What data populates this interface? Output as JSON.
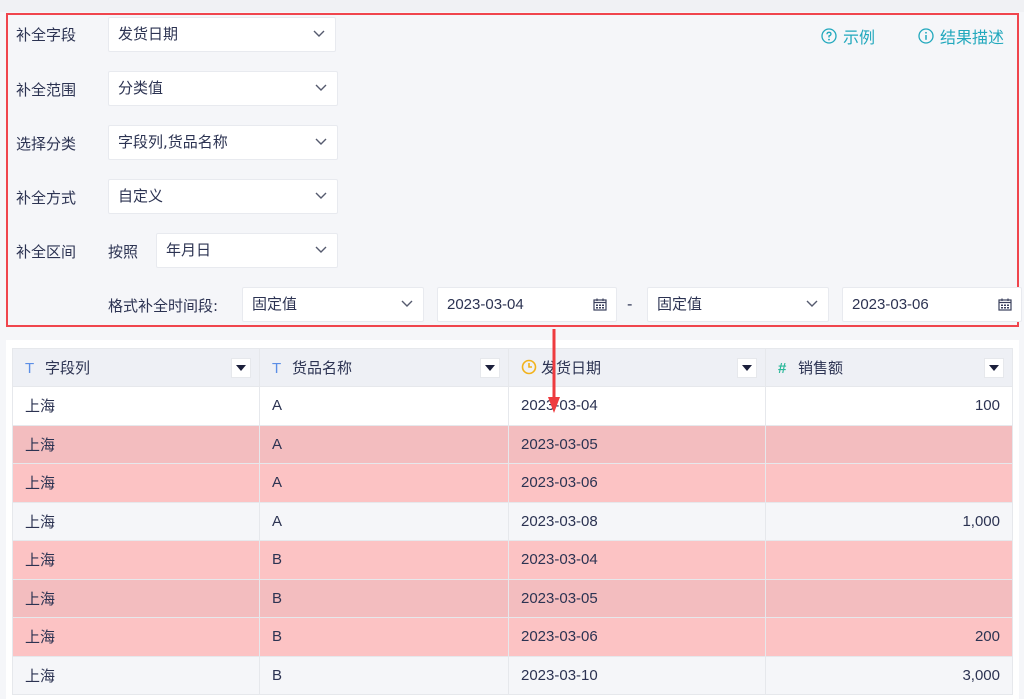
{
  "config": {
    "fill_field": {
      "label": "补全字段",
      "value": "发货日期"
    },
    "fill_scope": {
      "label": "补全范围",
      "value": "分类值"
    },
    "select_category": {
      "label": "选择分类",
      "value": "字段列,货品名称"
    },
    "fill_method": {
      "label": "补全方式",
      "value": "自定义"
    },
    "fill_interval": {
      "label": "补全区间",
      "by_label": "按照",
      "value": "年月日"
    },
    "time_range": {
      "label": "格式补全时间段:",
      "start_type": "固定值",
      "start_date": "2023-03-04",
      "separator": "-",
      "end_type": "固定值",
      "end_date": "2023-03-06"
    },
    "links": {
      "example": "示例",
      "result_desc": "结果描述"
    },
    "accent_color": "#21a8bd",
    "highlight_border_color": "#f0454d"
  },
  "table": {
    "columns": [
      {
        "icon": "text-type-icon",
        "glyph": "T",
        "label": "字段列"
      },
      {
        "icon": "text-type-icon",
        "glyph": "T",
        "label": "货品名称"
      },
      {
        "icon": "clock-icon",
        "glyph": "",
        "label": "发货日期"
      },
      {
        "icon": "number-type-icon",
        "glyph": "#",
        "label": "销售额"
      }
    ],
    "rows": [
      {
        "style": "white",
        "cells": [
          "上海",
          "A",
          "2023-03-04",
          "100"
        ]
      },
      {
        "style": "pinkdark",
        "cells": [
          "上海",
          "A",
          "2023-03-05",
          ""
        ]
      },
      {
        "style": "pink",
        "cells": [
          "上海",
          "A",
          "2023-03-06",
          ""
        ]
      },
      {
        "style": "light",
        "cells": [
          "上海",
          "A",
          "2023-03-08",
          "1,000"
        ]
      },
      {
        "style": "pink",
        "cells": [
          "上海",
          "B",
          "2023-03-04",
          ""
        ]
      },
      {
        "style": "pinkdark",
        "cells": [
          "上海",
          "B",
          "2023-03-05",
          ""
        ]
      },
      {
        "style": "pink",
        "cells": [
          "上海",
          "B",
          "2023-03-06",
          "200"
        ]
      },
      {
        "style": "light",
        "cells": [
          "上海",
          "B",
          "2023-03-10",
          "3,000"
        ]
      }
    ],
    "fill_row_color": "#fcc3c4"
  }
}
